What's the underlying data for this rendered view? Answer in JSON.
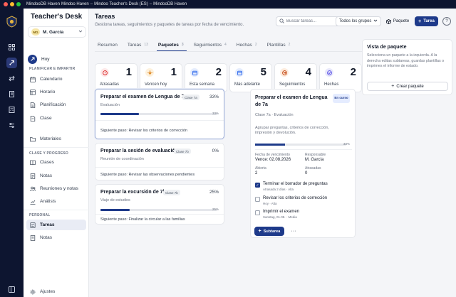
{
  "window": {
    "title": "MindooDB Haven",
    "segments": [
      "Mindoo Haven",
      "–",
      "Mindoo Teacher's Desk (ES)",
      "–",
      "MindooDB Haven"
    ]
  },
  "sidebar": {
    "brand": "Teacher's Desk",
    "user": {
      "initials": "MG",
      "name": "M. García"
    },
    "today": "Hoy",
    "sections": [
      {
        "title": "PLANIFICAR E IMPARTIR",
        "items": [
          "Calendario",
          "Horario",
          "Planificación",
          "Clase",
          "Materiales"
        ]
      },
      {
        "title": "CLASE Y PROGRESO",
        "items": [
          "Clases",
          "Notas",
          "Reuniones y notas",
          "Análisis"
        ]
      },
      {
        "title": "PERSONAL",
        "items": [
          "Tareas",
          "Notas"
        ]
      }
    ],
    "settings": "Ajustes"
  },
  "header": {
    "title": "Tareas",
    "subtitle": "Gestiona tareas, seguimientos y paquetes de tareas por fecha de vencimiento.",
    "search_placeholder": "Buscar tareas...",
    "group_select": "Todos los grupos",
    "package_button": "Paquete",
    "task_button": "Tarea",
    "help": "?"
  },
  "tabs": [
    {
      "label": "Resumen",
      "count": ""
    },
    {
      "label": "Tareas",
      "count": "13"
    },
    {
      "label": "Paquetes",
      "count": "3"
    },
    {
      "label": "Seguimientos",
      "count": "4"
    },
    {
      "label": "Hechas",
      "count": "2"
    },
    {
      "label": "Plantillas",
      "count": "2"
    }
  ],
  "stats": [
    {
      "label": "Atrasadas",
      "value": "1",
      "color": "#dc2626",
      "bg": "#fde8e8",
      "icon": "alert-icon"
    },
    {
      "label": "Vencen hoy",
      "value": "1",
      "color": "#d97706",
      "bg": "#fdf1dd",
      "icon": "sun-icon"
    },
    {
      "label": "Esta semana",
      "value": "2",
      "color": "#2563eb",
      "bg": "#e4ecfd",
      "icon": "calendar-icon"
    },
    {
      "label": "Más adelante",
      "value": "5",
      "color": "#2563eb",
      "bg": "#e4ecfd",
      "icon": "calendar-icon"
    },
    {
      "label": "Seguimientos",
      "value": "4",
      "color": "#c2410c",
      "bg": "#fdebdc",
      "icon": "followup-icon"
    },
    {
      "label": "Hechas",
      "value": "2",
      "color": "#4f46e5",
      "bg": "#e8e8fb",
      "icon": "check-icon"
    }
  ],
  "packages": [
    {
      "title": "Preparar el examen de Lengua de 7a",
      "class": "Clase 7a",
      "pct": "33%",
      "progress": 0.33,
      "subtitle": "Evaluación",
      "next": "Siguiente paso: Revisar los criterios de corrección"
    },
    {
      "title": "Preparar la sesión de evaluación",
      "class": "Clase 7b",
      "pct": "0%",
      "progress": 0,
      "subtitle": "Reunión de coordinación",
      "next": "Siguiente paso: Revisar las observaciones pendientes"
    },
    {
      "title": "Preparar la excursión de 7b",
      "class": "Clase 7b",
      "pct": "25%",
      "progress": 0.25,
      "subtitle": "Viaje de estudios",
      "next": "Siguiente paso: Finalizar la circular a las familias"
    }
  ],
  "detail": {
    "title": "Preparar el examen de Lengua de 7a",
    "status": "En curso",
    "subtitle": "Clase 7a · Evaluación",
    "description": "Agrupar preguntas, criterios de corrección, impresión y devolución.",
    "pct": "33%",
    "progress": 0.33,
    "fields": [
      {
        "label": "Fecha de vencimiento",
        "value": "Vence: 02.08.2026"
      },
      {
        "label": "Responsable",
        "value": "M. García"
      },
      {
        "label": "Abierta",
        "value": "2"
      },
      {
        "label": "Atrasadas",
        "value": "0"
      }
    ],
    "subtasks": [
      {
        "title": "Terminar el borrador de preguntas",
        "meta": "Atrasada 2 días · Alta",
        "done": true
      },
      {
        "title": "Revisar los criterios de corrección",
        "meta": "Hoy · Alta",
        "done": false
      },
      {
        "title": "Imprimir el examen",
        "meta": "Sanstag, 01.08. · Media",
        "done": false
      }
    ],
    "add_button": "Subtarea",
    "more": "···"
  },
  "package_panel": {
    "title": "Vista de paquete",
    "description": "Selecciona un paquete a la izquierda. A la derecha editas subtareas, guardas plantillas o imprimes el informe de estado.",
    "button": "Crear paquete"
  }
}
